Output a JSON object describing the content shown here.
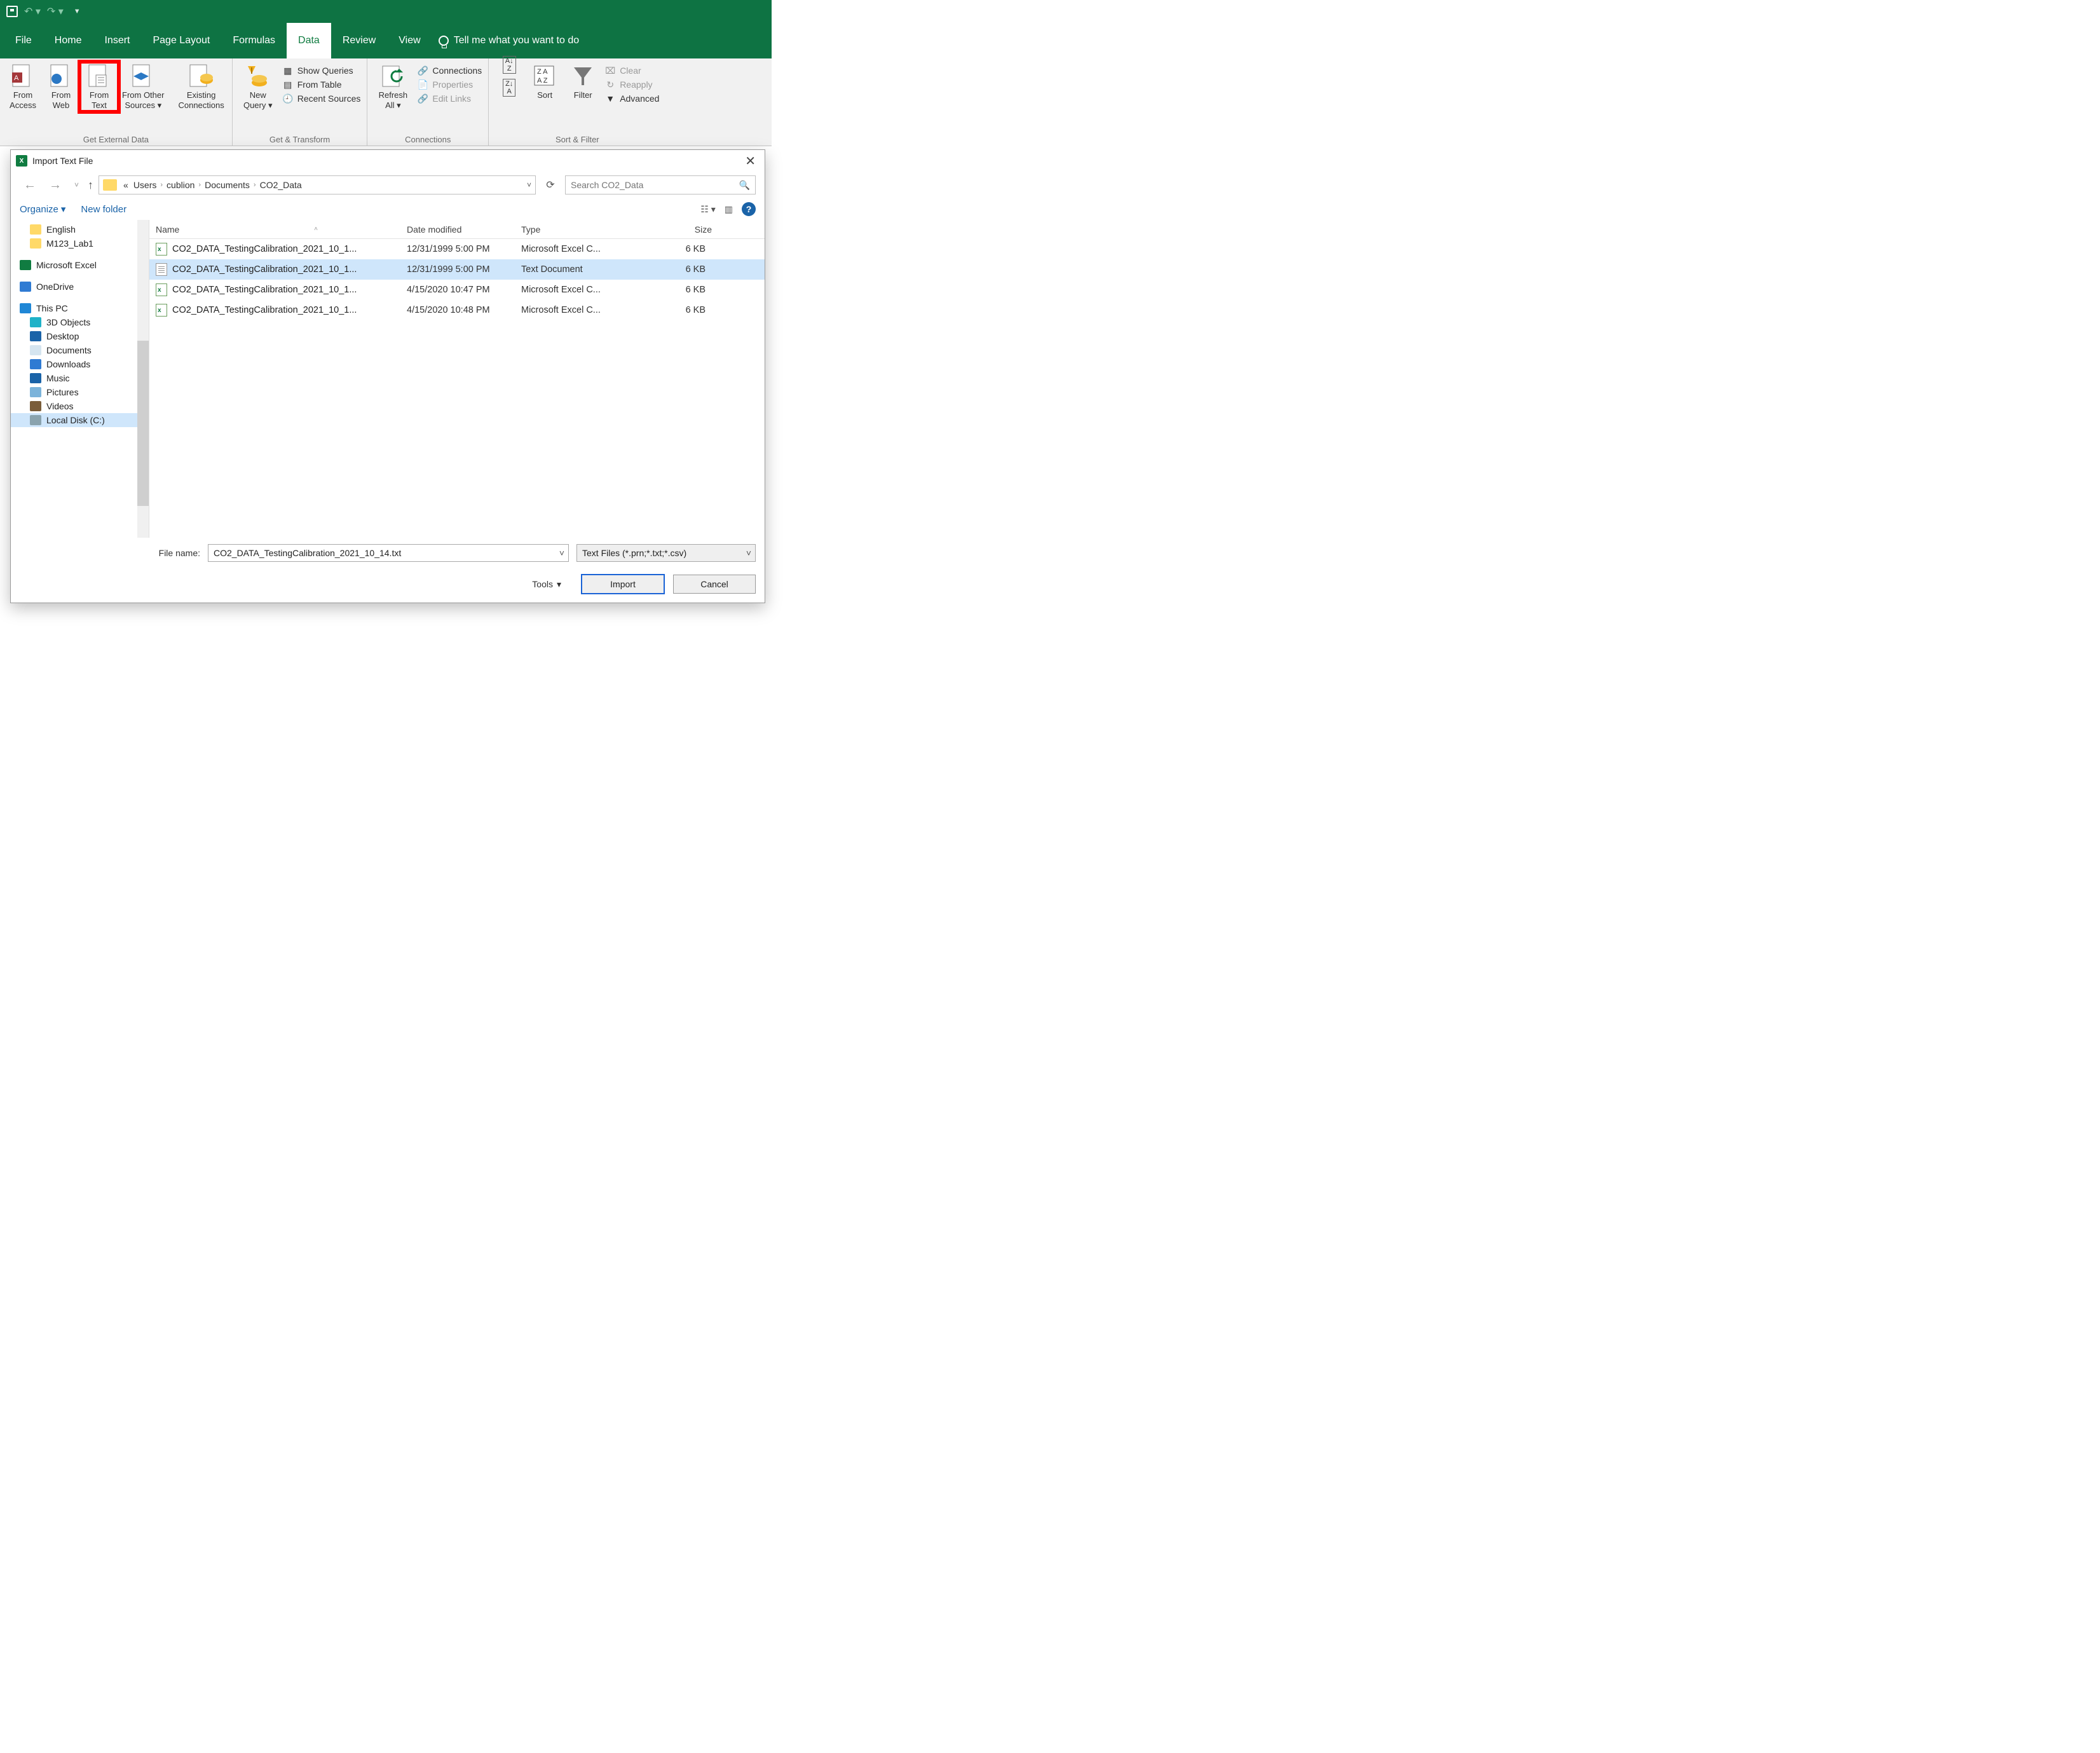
{
  "qat": {},
  "menu": {
    "file": "File",
    "home": "Home",
    "insert": "Insert",
    "page_layout": "Page Layout",
    "formulas": "Formulas",
    "data": "Data",
    "review": "Review",
    "view": "View",
    "tell_me": "Tell me what you want to do"
  },
  "ribbon": {
    "get_external_data": {
      "label": "Get External Data",
      "from_access": "From\nAccess",
      "from_web": "From\nWeb",
      "from_text": "From\nText",
      "from_other": "From Other\nSources",
      "existing": "Existing\nConnections"
    },
    "get_transform": {
      "label": "Get & Transform",
      "new_query": "New\nQuery",
      "show_queries": "Show Queries",
      "from_table": "From Table",
      "recent_sources": "Recent Sources"
    },
    "connections": {
      "label": "Connections",
      "refresh_all": "Refresh\nAll",
      "connections": "Connections",
      "properties": "Properties",
      "edit_links": "Edit Links"
    },
    "sort_filter": {
      "label": "Sort & Filter",
      "sort": "Sort",
      "filter": "Filter",
      "clear": "Clear",
      "reapply": "Reapply",
      "advanced": "Advanced"
    }
  },
  "dialog": {
    "title": "Import Text File",
    "breadcrumbs": [
      "«",
      "Users",
      "cublion",
      "Documents",
      "CO2_Data"
    ],
    "search_placeholder": "Search CO2_Data",
    "organize": "Organize",
    "new_folder": "New folder",
    "columns": {
      "name": "Name",
      "date": "Date modified",
      "type": "Type",
      "size": "Size"
    },
    "nav": {
      "english": "English",
      "m123": "M123_Lab1",
      "excel": "Microsoft Excel",
      "onedrive": "OneDrive",
      "this_pc": "This PC",
      "obj3d": "3D Objects",
      "desktop": "Desktop",
      "documents": "Documents",
      "downloads": "Downloads",
      "music": "Music",
      "pictures": "Pictures",
      "videos": "Videos",
      "local_disk": "Local Disk (C:)"
    },
    "files": [
      {
        "name": "CO2_DATA_TestingCalibration_2021_10_1...",
        "date": "12/31/1999 5:00 PM",
        "type": "Microsoft Excel C...",
        "size": "6 KB",
        "icon": "csv"
      },
      {
        "name": "CO2_DATA_TestingCalibration_2021_10_1...",
        "date": "12/31/1999 5:00 PM",
        "type": "Text Document",
        "size": "6 KB",
        "icon": "txt",
        "selected": true
      },
      {
        "name": "CO2_DATA_TestingCalibration_2021_10_1...",
        "date": "4/15/2020 10:47 PM",
        "type": "Microsoft Excel C...",
        "size": "6 KB",
        "icon": "csv"
      },
      {
        "name": "CO2_DATA_TestingCalibration_2021_10_1...",
        "date": "4/15/2020 10:48 PM",
        "type": "Microsoft Excel C...",
        "size": "6 KB",
        "icon": "csv"
      }
    ],
    "file_name_label": "File name:",
    "file_name_value": "CO2_DATA_TestingCalibration_2021_10_14.txt",
    "filter_value": "Text Files (*.prn;*.txt;*.csv)",
    "tools": "Tools",
    "import": "Import",
    "cancel": "Cancel"
  }
}
